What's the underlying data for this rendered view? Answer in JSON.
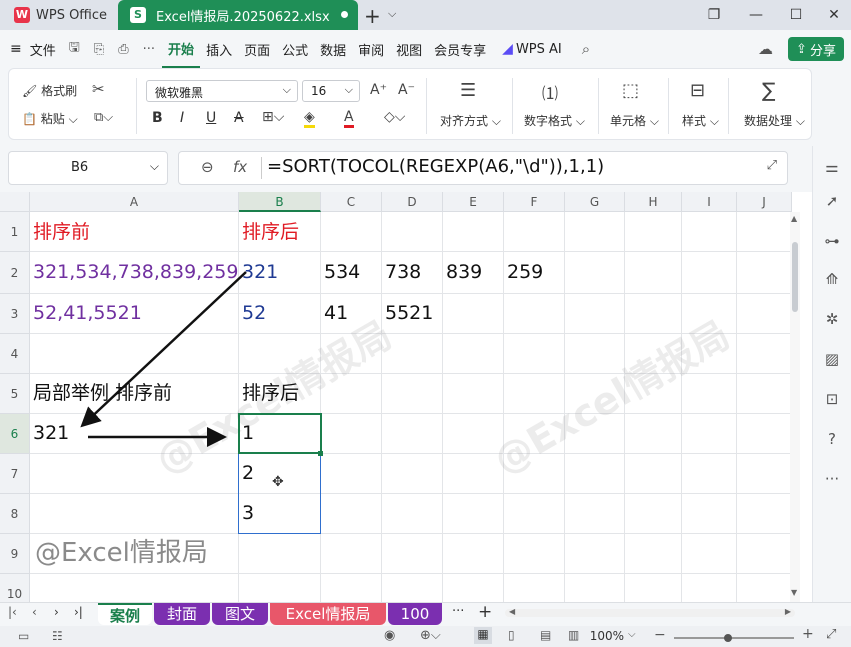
{
  "titlebar": {
    "app_name": "WPS Office",
    "file_tab": "Excel情报局.20250622.xlsx",
    "new_tab": "+"
  },
  "menu": {
    "file": "文件",
    "items": [
      "开始",
      "插入",
      "页面",
      "公式",
      "数据",
      "审阅",
      "视图",
      "会员专享"
    ],
    "wps_ai": "WPS AI",
    "share": "分享"
  },
  "ribbon": {
    "format_painter": "格式刷",
    "paste": "粘贴",
    "font_name": "微软雅黑",
    "font_size": "16",
    "align": "对齐方式",
    "number_format": "数字格式",
    "cell": "单元格",
    "style": "样式",
    "data_process": "数据处理"
  },
  "formula_bar": {
    "name_box": "B6",
    "fx": "fx",
    "formula": "=SORT(TOCOL(REGEXP(A6,\"\\d\")),1,1)"
  },
  "grid": {
    "columns": [
      "A",
      "B",
      "C",
      "D",
      "E",
      "F",
      "G",
      "H",
      "I",
      "J"
    ],
    "rows": [
      "1",
      "2",
      "3",
      "4",
      "5",
      "6",
      "7",
      "8",
      "9",
      "10"
    ],
    "cells": {
      "A1": "排序前",
      "B1": "排序后",
      "A2": "321,534,738,839,259",
      "B2": "321",
      "C2": "534",
      "D2": "738",
      "E2": "839",
      "F2": "259",
      "A3": "52,41,5521",
      "B3": "52",
      "C3": "41",
      "D3": "5521",
      "A5": "局部举例 排序前",
      "B5": "排序后",
      "A6": "321",
      "B6": "1",
      "B7": "2",
      "B8": "3",
      "A9": "@Excel情报局"
    },
    "watermark": "@Excel情报局"
  },
  "sheets": {
    "tabs": [
      "案例",
      "封面",
      "图文",
      "Excel情报局",
      "100"
    ],
    "active": "案例",
    "more": "···",
    "add": "+"
  },
  "status": {
    "zoom": "100%"
  },
  "colors": {
    "accent": "#1f8f57",
    "red_text": "#e01b24",
    "purple_text": "#7030a0",
    "navy_text": "#1f3a93",
    "tab_purple": "#7b2fb0",
    "tab_red": "#e8576a"
  }
}
